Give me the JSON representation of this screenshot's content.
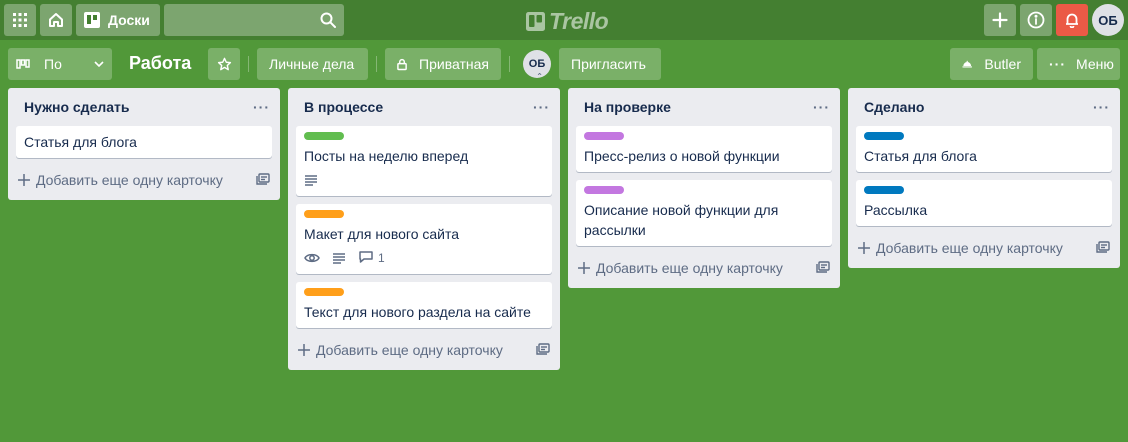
{
  "header": {
    "boards_label": "Доски",
    "search_value": "",
    "logo_text": "Trello",
    "user_initials": "ОБ"
  },
  "board": {
    "view_label": "По",
    "title": "Работа",
    "team_label": "Личные дела",
    "visibility_label": "Приватная",
    "member_initials": "ОБ",
    "invite_label": "Пригласить",
    "butler_label": "Butler",
    "menu_label": "Меню"
  },
  "label_colors": {
    "green": "#61bd4f",
    "orange": "#ff9f1a",
    "purple": "#c377e0",
    "blue": "#0079bf"
  },
  "lists": [
    {
      "title": "Нужно сделать",
      "add_label": "Добавить еще одну карточку",
      "cards": [
        {
          "text": "Статья для блога"
        }
      ]
    },
    {
      "title": "В процессе",
      "add_label": "Добавить еще одну карточку",
      "cards": [
        {
          "label": "green",
          "text": "Посты на неделю вперед",
          "badges": [
            "description-icon"
          ]
        },
        {
          "label": "orange",
          "text": "Макет для нового сайта",
          "badges": [
            "watch-icon",
            "description-icon",
            "comment-icon"
          ],
          "comments": "1"
        },
        {
          "label": "orange",
          "text": "Текст для нового раздела на сайте"
        }
      ]
    },
    {
      "title": "На проверке",
      "add_label": "Добавить еще одну карточку",
      "cards": [
        {
          "label": "purple",
          "text": "Пресс-релиз о новой функции"
        },
        {
          "label": "purple",
          "text": "Описание новой функции для рассылки"
        }
      ]
    },
    {
      "title": "Сделано",
      "add_label": "Добавить еще одну карточку",
      "cards": [
        {
          "label": "blue",
          "text": "Статья для блога"
        },
        {
          "label": "blue",
          "text": "Рассылка"
        }
      ]
    }
  ]
}
